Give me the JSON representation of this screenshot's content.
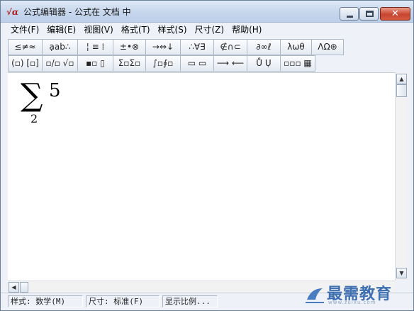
{
  "window": {
    "app_icon": "√α",
    "title": "公式编辑器 - 公式在 文档 中",
    "controls": {
      "minimize": "minimize-icon",
      "maximize": "maximize-icon",
      "close": "close-icon"
    }
  },
  "menu": {
    "items": [
      {
        "label": "文件(F)"
      },
      {
        "label": "编辑(E)"
      },
      {
        "label": "视图(V)"
      },
      {
        "label": "格式(T)"
      },
      {
        "label": "样式(S)"
      },
      {
        "label": "尺寸(Z)"
      },
      {
        "label": "帮助(H)"
      }
    ]
  },
  "toolbar": {
    "row1": [
      {
        "glyphs": "≤≠≈",
        "icon": "relational-symbols-icon"
      },
      {
        "glyphs": "ạab∴",
        "icon": "spaces-ellipses-icon"
      },
      {
        "glyphs": "¦ ≡ ⁞",
        "icon": "embellishments-icon"
      },
      {
        "glyphs": "±•⊗",
        "icon": "operator-symbols-icon"
      },
      {
        "glyphs": "→⇔↓",
        "icon": "arrow-symbols-icon"
      },
      {
        "glyphs": "∴∀∃",
        "icon": "logical-symbols-icon"
      },
      {
        "glyphs": "∉∩⊂",
        "icon": "set-theory-symbols-icon"
      },
      {
        "glyphs": "∂∞ℓ",
        "icon": "misc-symbols-icon"
      },
      {
        "glyphs": "λωθ",
        "icon": "greek-lowercase-icon"
      },
      {
        "glyphs": "ΛΩ⊛",
        "icon": "greek-uppercase-icon"
      }
    ],
    "row2": [
      {
        "glyphs": "(▫) [▫]",
        "icon": "fence-templates-icon"
      },
      {
        "glyphs": "▫/▫ √▫",
        "icon": "fraction-radical-templates-icon"
      },
      {
        "glyphs": "▪▫ ▯",
        "icon": "subscript-superscript-templates-icon"
      },
      {
        "glyphs": "Σ▫Σ▫",
        "icon": "summation-templates-icon"
      },
      {
        "glyphs": "∫▫∮▫",
        "icon": "integral-templates-icon"
      },
      {
        "glyphs": "▭ ▭",
        "icon": "underbar-overbar-templates-icon"
      },
      {
        "glyphs": "⟶ ⟵",
        "icon": "labeled-arrow-templates-icon"
      },
      {
        "glyphs": "Ů Ụ",
        "icon": "products-set-theory-templates-icon"
      },
      {
        "glyphs": "▫▫▫ ▦",
        "icon": "matrix-templates-icon"
      }
    ]
  },
  "editor": {
    "formula": {
      "operator": "∑",
      "lower_limit": "2",
      "operand": "5"
    }
  },
  "statusbar": {
    "style": "样式: 数学(M)",
    "size": "尺寸: 标准(F)",
    "zoom": "显示比例..."
  },
  "watermark": {
    "text": "最需教育",
    "url": "www.zuixu.com"
  },
  "colors": {
    "titlebar": "#c6d6ec",
    "close_button": "#c8452f",
    "watermark": "#3e6fb0"
  }
}
